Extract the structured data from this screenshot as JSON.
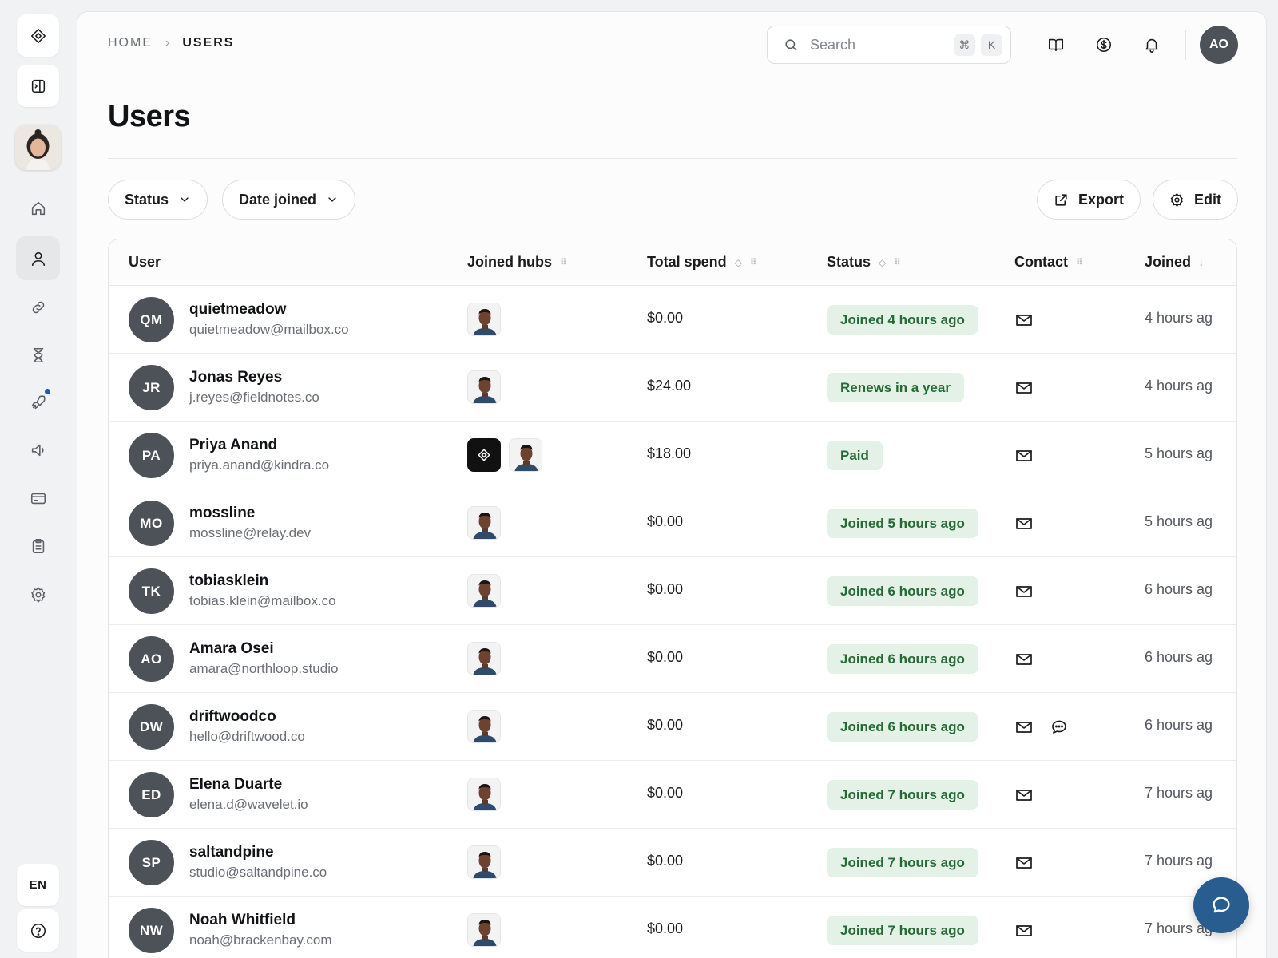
{
  "rail": {
    "logo_icon": "diamond-logo-icon",
    "toggle_icon": "sidebar-toggle-icon",
    "nav": [
      {
        "name": "home",
        "icon": "home-icon",
        "active": false
      },
      {
        "name": "users",
        "icon": "user-icon",
        "active": true
      },
      {
        "name": "links",
        "icon": "link-icon",
        "active": false
      },
      {
        "name": "waitlist",
        "icon": "hourglass-icon",
        "active": false
      },
      {
        "name": "launch",
        "icon": "rocket-icon",
        "active": false,
        "notification_dot": true
      },
      {
        "name": "announcements",
        "icon": "megaphone-icon",
        "active": false
      },
      {
        "name": "billing",
        "icon": "credit-card-icon",
        "active": false
      },
      {
        "name": "reports",
        "icon": "clipboard-icon",
        "active": false
      },
      {
        "name": "settings",
        "icon": "gear-icon",
        "active": false
      }
    ],
    "language": "EN",
    "help_icon": "help-icon"
  },
  "breadcrumb": {
    "home": "HOME",
    "current": "USERS"
  },
  "search": {
    "placeholder": "Search",
    "shortcut_mod": "⌘",
    "shortcut_key": "K"
  },
  "header": {
    "avatar_initials": "AO"
  },
  "page": {
    "title": "Users"
  },
  "filters": {
    "status": "Status",
    "date_joined": "Date joined"
  },
  "actions": {
    "export": "Export",
    "edit": "Edit"
  },
  "table": {
    "columns": [
      "User",
      "Joined hubs",
      "Total spend",
      "Status",
      "Contact",
      "Joined"
    ],
    "rows": [
      {
        "initials": "QM",
        "name": "quietmeadow",
        "email": "quietmeadow@mailbox.co",
        "hubs": [
          "person"
        ],
        "spend": "$0.00",
        "status": "Joined 4 hours ago",
        "contact": [
          "mail"
        ],
        "joined": "4 hours ag"
      },
      {
        "initials": "JR",
        "name": "Jonas Reyes",
        "email": "j.reyes@fieldnotes.co",
        "hubs": [
          "person"
        ],
        "spend": "$24.00",
        "status": "Renews in a year",
        "contact": [
          "mail"
        ],
        "joined": "4 hours ag"
      },
      {
        "initials": "PA",
        "name": "Priya Anand",
        "email": "priya.anand@kindra.co",
        "hubs": [
          "logo",
          "person"
        ],
        "spend": "$18.00",
        "status": "Paid",
        "contact": [
          "mail"
        ],
        "joined": "5 hours ag"
      },
      {
        "initials": "MO",
        "name": "mossline",
        "email": "mossline@relay.dev",
        "hubs": [
          "person"
        ],
        "spend": "$0.00",
        "status": "Joined 5 hours ago",
        "contact": [
          "mail"
        ],
        "joined": "5 hours ag"
      },
      {
        "initials": "TK",
        "name": "tobiasklein",
        "email": "tobias.klein@mailbox.co",
        "hubs": [
          "person"
        ],
        "spend": "$0.00",
        "status": "Joined 6 hours ago",
        "contact": [
          "mail"
        ],
        "joined": "6 hours ag"
      },
      {
        "initials": "AO",
        "name": "Amara Osei",
        "email": "amara@northloop.studio",
        "hubs": [
          "person"
        ],
        "spend": "$0.00",
        "status": "Joined 6 hours ago",
        "contact": [
          "mail"
        ],
        "joined": "6 hours ag"
      },
      {
        "initials": "DW",
        "name": "driftwoodco",
        "email": "hello@driftwood.co",
        "hubs": [
          "person"
        ],
        "spend": "$0.00",
        "status": "Joined 6 hours ago",
        "contact": [
          "mail",
          "chat"
        ],
        "joined": "6 hours ag"
      },
      {
        "initials": "ED",
        "name": "Elena Duarte",
        "email": "elena.d@wavelet.io",
        "hubs": [
          "person"
        ],
        "spend": "$0.00",
        "status": "Joined 7 hours ago",
        "contact": [
          "mail"
        ],
        "joined": "7 hours ag"
      },
      {
        "initials": "SP",
        "name": "saltandpine",
        "email": "studio@saltandpine.co",
        "hubs": [
          "person"
        ],
        "spend": "$0.00",
        "status": "Joined 7 hours ago",
        "contact": [
          "mail"
        ],
        "joined": "7 hours ag"
      },
      {
        "initials": "NW",
        "name": "Noah Whitfield",
        "email": "noah@brackenbay.com",
        "hubs": [
          "person"
        ],
        "spend": "$0.00",
        "status": "Joined 7 hours ago",
        "contact": [
          "mail"
        ],
        "joined": "7 hours ag"
      }
    ]
  },
  "colors": {
    "badge_bg": "#e4f1e6",
    "badge_text": "#256b35",
    "fab": "#2a5d8f",
    "avatar": "#4d5259",
    "accent_dot": "#2557a7"
  },
  "fab": {
    "icon": "chat-bubble-icon"
  }
}
